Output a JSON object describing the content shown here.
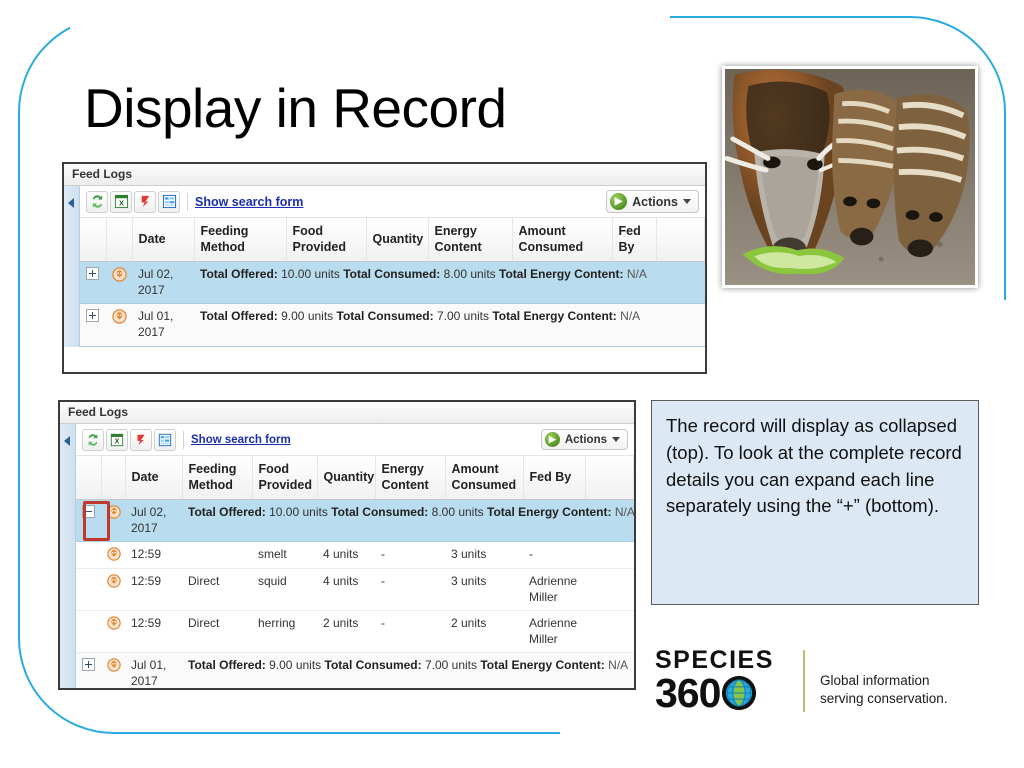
{
  "slide": {
    "title": "Display in Record",
    "frame_color": "#29ABE2"
  },
  "photo": {
    "alt": "red river hog adult and two striped piglets eating lettuce"
  },
  "panel_top": {
    "panel_title": "Feed Logs",
    "toolbar": {
      "icons": [
        "refresh-icon",
        "excel-export-icon",
        "pdf-export-icon",
        "tree-view-icon"
      ],
      "search_link": "Show search form",
      "actions_label": "Actions"
    },
    "columns": [
      "",
      "",
      "Date",
      "Feeding Method",
      "Food Provided",
      "Quantity",
      "Energy Content",
      "Amount Consumed",
      "Fed By",
      ""
    ],
    "rows": [
      {
        "expander": "+",
        "date": "Jul 02, 2017",
        "summary": {
          "offered_label": "Total Offered:",
          "offered_value": "10.00 units",
          "consumed_label": "Total Consumed:",
          "consumed_value": "8.00 units",
          "energy_label": "Total Energy Content:",
          "energy_value": "N/A"
        },
        "highlighted": true
      },
      {
        "expander": "+",
        "date": "Jul 01, 2017",
        "summary": {
          "offered_label": "Total Offered:",
          "offered_value": "9.00 units",
          "consumed_label": "Total Consumed:",
          "consumed_value": "7.00 units",
          "energy_label": "Total Energy Content:",
          "energy_value": "N/A"
        },
        "highlighted": false
      }
    ]
  },
  "panel_bottom": {
    "panel_title": "Feed Logs",
    "toolbar": {
      "icons": [
        "refresh-icon",
        "excel-export-icon",
        "pdf-export-icon",
        "tree-view-icon"
      ],
      "search_link": "Show search form",
      "actions_label": "Actions"
    },
    "columns": [
      "",
      "",
      "Date",
      "Feeding Method",
      "Food Provided",
      "Quantity",
      "Energy Content",
      "Amount Consumed",
      "Fed By",
      ""
    ],
    "summary_row_1": {
      "expander": "−",
      "date": "Jul 02, 2017",
      "offered_label": "Total Offered:",
      "offered_value": "10.00 units",
      "consumed_label": "Total Consumed:",
      "consumed_value": "8.00 units",
      "energy_label": "Total Energy Content:",
      "energy_value": "N/A"
    },
    "detail_rows": [
      {
        "time": "12:59",
        "feeding_method": "",
        "food_provided": "smelt",
        "quantity": "4 units",
        "energy_content": "-",
        "amount_consumed": "3 units",
        "fed_by": "-"
      },
      {
        "time": "12:59",
        "feeding_method": "Direct",
        "food_provided": "squid",
        "quantity": "4 units",
        "energy_content": "-",
        "amount_consumed": "3 units",
        "fed_by": "Adrienne Miller"
      },
      {
        "time": "12:59",
        "feeding_method": "Direct",
        "food_provided": "herring",
        "quantity": "2 units",
        "energy_content": "-",
        "amount_consumed": "2 units",
        "fed_by": "Adrienne Miller"
      }
    ],
    "summary_row_2": {
      "expander": "+",
      "date": "Jul 01, 2017",
      "offered_label": "Total Offered:",
      "offered_value": "9.00 units",
      "consumed_label": "Total Consumed:",
      "consumed_value": "7.00 units",
      "energy_label": "Total Energy Content:",
      "energy_value": "N/A"
    },
    "highlight_box_color": "#c0392b"
  },
  "callout": {
    "text": "The record will display as collapsed (top). To look at the complete record details you can expand each line separately using the “+” (bottom).",
    "background": "#dce8f4"
  },
  "logo": {
    "species": "SPECIES",
    "number": "360",
    "tagline_line1": "Global information",
    "tagline_line2": "serving conservation."
  }
}
